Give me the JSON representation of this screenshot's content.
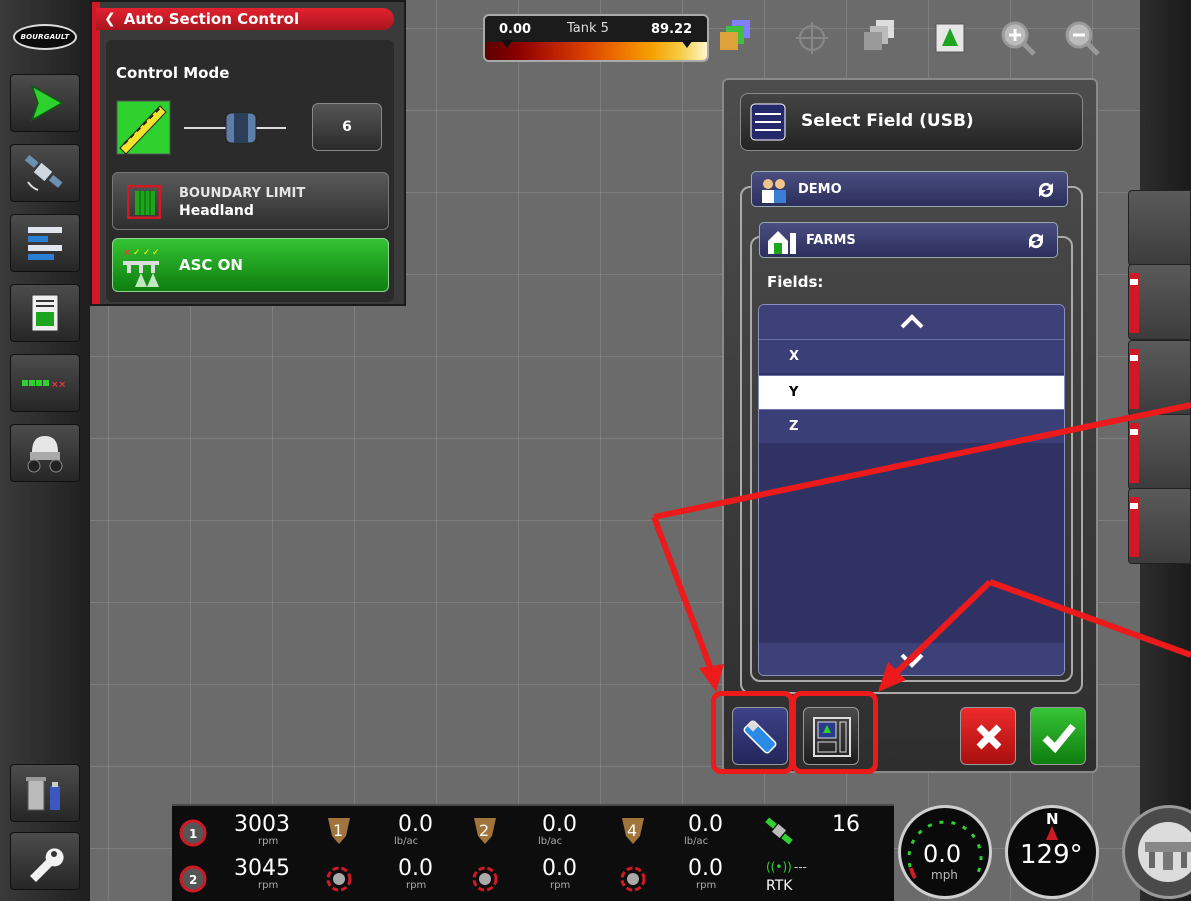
{
  "logo": {
    "text": "BOURGAULT"
  },
  "asc": {
    "title": "Auto Section Control",
    "control_mode_label": "Control Mode",
    "mode_value": "6",
    "boundary_label": "BOUNDARY LIMIT",
    "boundary_value": "Headland",
    "asc_on_label": "ASC ON"
  },
  "tank": {
    "min": "0.00",
    "name": "Tank 5",
    "max": "89.22"
  },
  "select_field": {
    "title": "Select Field (USB)",
    "client": "DEMO",
    "farm": "FARMS",
    "fields_label": "Fields:",
    "fields": [
      {
        "name": "X",
        "selected": false
      },
      {
        "name": "Y",
        "selected": true
      },
      {
        "name": "Z",
        "selected": false
      }
    ]
  },
  "status": {
    "fan1_rpm": "3003",
    "fan2_rpm": "3045",
    "rpm_unit": "rpm",
    "rate_unit": "lb/ac",
    "tanks": [
      {
        "num": "1",
        "rate": "0.0",
        "rpm": "0.0"
      },
      {
        "num": "2",
        "rate": "0.0",
        "rpm": "0.0"
      },
      {
        "num": "4",
        "rate": "0.0",
        "rpm": "0.0"
      }
    ],
    "satellites": "16",
    "signal": "---",
    "gps_mode": "RTK"
  },
  "speed": {
    "value": "0.0",
    "unit": "mph"
  },
  "heading": {
    "value": "129°",
    "north": "N"
  },
  "colors": {
    "accent_red": "#cf1a26",
    "asc_green": "#1ea51e",
    "list_blue": "#2f3263",
    "annotation_red": "#ec1a1a"
  }
}
